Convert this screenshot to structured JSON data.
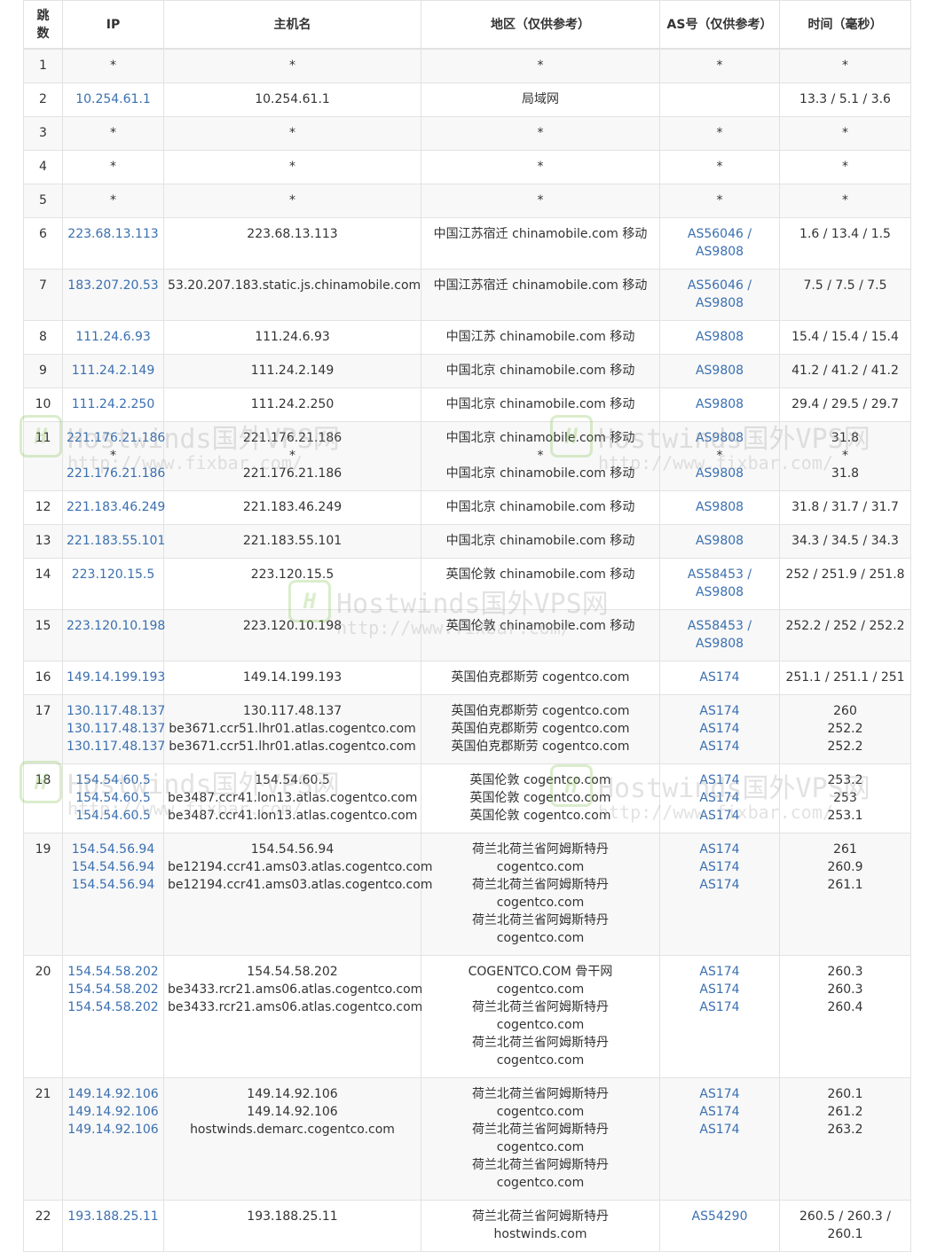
{
  "headers": [
    "跳数",
    "IP",
    "主机名",
    "地区（仅供参考）",
    "AS号（仅供参考）",
    "时间（毫秒）"
  ],
  "watermark": {
    "title": "Hostwinds国外VPS网",
    "url": "http://www.fixbar.com/"
  },
  "rows": [
    {
      "hop": "1",
      "ip": [
        "*"
      ],
      "host": [
        "*"
      ],
      "region": [
        "*"
      ],
      "as": [
        "*"
      ],
      "time": [
        "*"
      ]
    },
    {
      "hop": "2",
      "ip": [
        "10.254.61.1"
      ],
      "host": [
        "10.254.61.1"
      ],
      "region": [
        "局域网"
      ],
      "as": [],
      "time": [
        "13.3 / 5.1 / 3.6"
      ]
    },
    {
      "hop": "3",
      "ip": [
        "*"
      ],
      "host": [
        "*"
      ],
      "region": [
        "*"
      ],
      "as": [
        "*"
      ],
      "time": [
        "*"
      ]
    },
    {
      "hop": "4",
      "ip": [
        "*"
      ],
      "host": [
        "*"
      ],
      "region": [
        "*"
      ],
      "as": [
        "*"
      ],
      "time": [
        "*"
      ]
    },
    {
      "hop": "5",
      "ip": [
        "*"
      ],
      "host": [
        "*"
      ],
      "region": [
        "*"
      ],
      "as": [
        "*"
      ],
      "time": [
        "*"
      ]
    },
    {
      "hop": "6",
      "ip": [
        "223.68.13.113"
      ],
      "host": [
        "223.68.13.113"
      ],
      "region": [
        "中国江苏宿迁 chinamobile.com 移动"
      ],
      "as": [
        "AS56046 /",
        "AS9808"
      ],
      "time": [
        "1.6 / 13.4 / 1.5"
      ]
    },
    {
      "hop": "7",
      "ip": [
        "183.207.20.53"
      ],
      "host": [
        "53.20.207.183.static.js.chinamobile.com"
      ],
      "region": [
        "中国江苏宿迁 chinamobile.com 移动"
      ],
      "as": [
        "AS56046 /",
        "AS9808"
      ],
      "time": [
        "7.5 / 7.5 / 7.5"
      ]
    },
    {
      "hop": "8",
      "ip": [
        "111.24.6.93"
      ],
      "host": [
        "111.24.6.93"
      ],
      "region": [
        "中国江苏 chinamobile.com 移动"
      ],
      "as": [
        "AS9808"
      ],
      "time": [
        "15.4 / 15.4 / 15.4"
      ]
    },
    {
      "hop": "9",
      "ip": [
        "111.24.2.149"
      ],
      "host": [
        "111.24.2.149"
      ],
      "region": [
        "中国北京 chinamobile.com 移动"
      ],
      "as": [
        "AS9808"
      ],
      "time": [
        "41.2 / 41.2 / 41.2"
      ]
    },
    {
      "hop": "10",
      "ip": [
        "111.24.2.250"
      ],
      "host": [
        "111.24.2.250"
      ],
      "region": [
        "中国北京 chinamobile.com 移动"
      ],
      "as": [
        "AS9808"
      ],
      "time": [
        "29.4 / 29.5 / 29.7"
      ]
    },
    {
      "hop": "11",
      "ip": [
        "221.176.21.186",
        "*",
        "221.176.21.186"
      ],
      "host": [
        "221.176.21.186",
        "*",
        "221.176.21.186"
      ],
      "region": [
        "中国北京 chinamobile.com 移动",
        "*",
        "中国北京 chinamobile.com 移动"
      ],
      "as": [
        "AS9808",
        "*",
        "AS9808"
      ],
      "time": [
        "31.8",
        "*",
        "31.8"
      ]
    },
    {
      "hop": "12",
      "ip": [
        "221.183.46.249"
      ],
      "host": [
        "221.183.46.249"
      ],
      "region": [
        "中国北京 chinamobile.com 移动"
      ],
      "as": [
        "AS9808"
      ],
      "time": [
        "31.8 / 31.7 / 31.7"
      ]
    },
    {
      "hop": "13",
      "ip": [
        "221.183.55.101"
      ],
      "host": [
        "221.183.55.101"
      ],
      "region": [
        "中国北京 chinamobile.com 移动"
      ],
      "as": [
        "AS9808"
      ],
      "time": [
        "34.3 / 34.5 / 34.3"
      ]
    },
    {
      "hop": "14",
      "ip": [
        "223.120.15.5"
      ],
      "host": [
        "223.120.15.5"
      ],
      "region": [
        "英国伦敦 chinamobile.com 移动"
      ],
      "as": [
        "AS58453 /",
        "AS9808"
      ],
      "time": [
        "252 / 251.9 / 251.8"
      ]
    },
    {
      "hop": "15",
      "ip": [
        "223.120.10.198"
      ],
      "host": [
        "223.120.10.198"
      ],
      "region": [
        "英国伦敦 chinamobile.com 移动"
      ],
      "as": [
        "AS58453 /",
        "AS9808"
      ],
      "time": [
        "252.2 / 252 / 252.2"
      ]
    },
    {
      "hop": "16",
      "ip": [
        "149.14.199.193"
      ],
      "host": [
        "149.14.199.193"
      ],
      "region": [
        "英国伯克郡斯劳 cogentco.com"
      ],
      "as": [
        "AS174"
      ],
      "time": [
        "251.1 / 251.1 / 251"
      ]
    },
    {
      "hop": "17",
      "ip": [
        "130.117.48.137",
        "130.117.48.137",
        "130.117.48.137"
      ],
      "host": [
        "130.117.48.137",
        "be3671.ccr51.lhr01.atlas.cogentco.com",
        "be3671.ccr51.lhr01.atlas.cogentco.com"
      ],
      "region": [
        "英国伯克郡斯劳 cogentco.com",
        "英国伯克郡斯劳 cogentco.com",
        "英国伯克郡斯劳 cogentco.com"
      ],
      "as": [
        "AS174",
        "AS174",
        "AS174"
      ],
      "time": [
        "260",
        "252.2",
        "252.2"
      ]
    },
    {
      "hop": "18",
      "ip": [
        "154.54.60.5",
        "154.54.60.5",
        "154.54.60.5"
      ],
      "host": [
        "154.54.60.5",
        "be3487.ccr41.lon13.atlas.cogentco.com",
        "be3487.ccr41.lon13.atlas.cogentco.com"
      ],
      "region": [
        "英国伦敦 cogentco.com",
        "英国伦敦 cogentco.com",
        "英国伦敦 cogentco.com"
      ],
      "as": [
        "AS174",
        "AS174",
        "AS174"
      ],
      "time": [
        "253.2",
        "253",
        "253.1"
      ]
    },
    {
      "hop": "19",
      "ip": [
        "154.54.56.94",
        "154.54.56.94",
        "154.54.56.94"
      ],
      "host": [
        "154.54.56.94",
        "be12194.ccr41.ams03.atlas.cogentco.com",
        "be12194.ccr41.ams03.atlas.cogentco.com"
      ],
      "region": [
        "荷兰北荷兰省阿姆斯特丹",
        "cogentco.com",
        "荷兰北荷兰省阿姆斯特丹",
        "cogentco.com",
        "荷兰北荷兰省阿姆斯特丹",
        "cogentco.com"
      ],
      "as": [
        "AS174",
        "AS174",
        "AS174"
      ],
      "time": [
        "261",
        "260.9",
        "261.1"
      ]
    },
    {
      "hop": "20",
      "ip": [
        "154.54.58.202",
        "154.54.58.202",
        "154.54.58.202"
      ],
      "host": [
        "154.54.58.202",
        "be3433.rcr21.ams06.atlas.cogentco.com",
        "be3433.rcr21.ams06.atlas.cogentco.com"
      ],
      "region": [
        "COGENTCO.COM 骨干网",
        "cogentco.com",
        "荷兰北荷兰省阿姆斯特丹",
        "cogentco.com",
        "荷兰北荷兰省阿姆斯特丹",
        "cogentco.com"
      ],
      "as": [
        "AS174",
        "AS174",
        "AS174"
      ],
      "time": [
        "260.3",
        "260.3",
        "260.4"
      ]
    },
    {
      "hop": "21",
      "ip": [
        "149.14.92.106",
        "149.14.92.106",
        "149.14.92.106"
      ],
      "host": [
        "149.14.92.106",
        "149.14.92.106",
        "hostwinds.demarc.cogentco.com"
      ],
      "region": [
        "荷兰北荷兰省阿姆斯特丹",
        "cogentco.com",
        "荷兰北荷兰省阿姆斯特丹",
        "cogentco.com",
        "荷兰北荷兰省阿姆斯特丹",
        "cogentco.com"
      ],
      "as": [
        "AS174",
        "AS174",
        "AS174"
      ],
      "time": [
        "260.1",
        "261.2",
        "263.2"
      ]
    },
    {
      "hop": "22",
      "ip": [
        "193.188.25.11"
      ],
      "host": [
        "193.188.25.11"
      ],
      "region": [
        "荷兰北荷兰省阿姆斯特丹",
        "hostwinds.com"
      ],
      "as": [
        "AS54290"
      ],
      "time": [
        "260.5 / 260.3 /",
        "260.1"
      ]
    }
  ]
}
